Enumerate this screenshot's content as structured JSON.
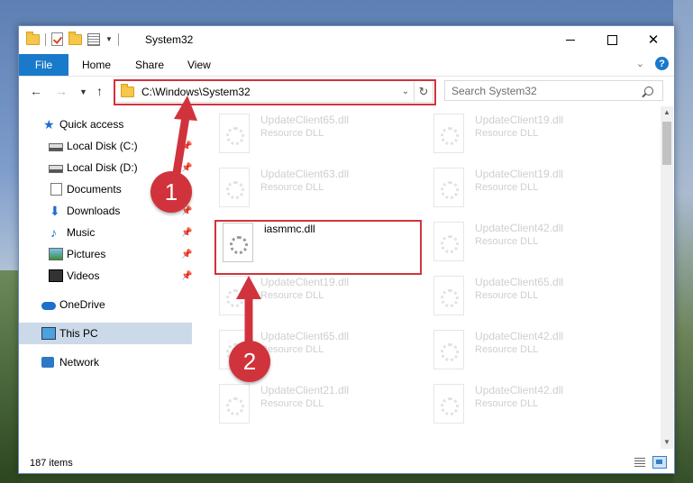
{
  "window": {
    "title": "System32"
  },
  "ribbon": {
    "file": "File",
    "home": "Home",
    "share": "Share",
    "view": "View"
  },
  "address": {
    "path": "C:\\Windows\\System32"
  },
  "search": {
    "placeholder": "Search System32"
  },
  "sidebar": {
    "items": [
      {
        "label": "Quick access",
        "icon": "star-icon"
      },
      {
        "label": "Local Disk (C:)",
        "icon": "drive-icon",
        "pinned": true
      },
      {
        "label": "Local Disk (D:)",
        "icon": "drive-icon",
        "pinned": true
      },
      {
        "label": "Documents",
        "icon": "documents-icon",
        "pinned": true
      },
      {
        "label": "Downloads",
        "icon": "downloads-icon",
        "pinned": true
      },
      {
        "label": "Music",
        "icon": "music-icon",
        "pinned": true
      },
      {
        "label": "Pictures",
        "icon": "pictures-icon",
        "pinned": true
      },
      {
        "label": "Videos",
        "icon": "videos-icon",
        "pinned": true
      },
      {
        "label": "OneDrive",
        "icon": "onedrive-icon"
      },
      {
        "label": "This PC",
        "icon": "pc-icon",
        "selected": true
      },
      {
        "label": "Network",
        "icon": "network-icon"
      }
    ]
  },
  "files": {
    "left": [
      {
        "name": "UpdateClient65.dll",
        "type": "Resource DLL"
      },
      {
        "name": "UpdateClient63.dll",
        "type": "Resource DLL"
      },
      {
        "name": "iasmmc.dll",
        "type": ""
      },
      {
        "name": "UpdateClient19.dll",
        "type": "Resource DLL"
      },
      {
        "name": "UpdateClient65.dll",
        "type": "Resource DLL"
      },
      {
        "name": "UpdateClient21.dll",
        "type": "Resource DLL"
      }
    ],
    "right": [
      {
        "name": "UpdateClient19.dll",
        "type": "Resource DLL"
      },
      {
        "name": "UpdateClient19.dll",
        "type": "Resource DLL"
      },
      {
        "name": "UpdateClient42.dll",
        "type": "Resource DLL"
      },
      {
        "name": "UpdateClient65.dll",
        "type": "Resource DLL"
      },
      {
        "name": "UpdateClient42.dll",
        "type": "Resource DLL"
      },
      {
        "name": "UpdateClient42.dll",
        "type": "Resource DLL"
      }
    ]
  },
  "status": {
    "count": "187 items"
  },
  "annotations": {
    "step1": "1",
    "step2": "2",
    "color": "#d1333c"
  }
}
